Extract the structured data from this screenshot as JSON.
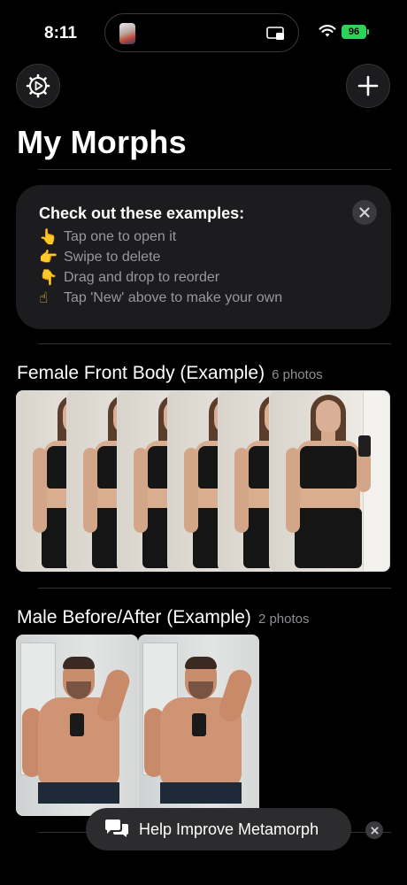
{
  "status_bar": {
    "time": "8:11",
    "battery": "96"
  },
  "header": {
    "title": "My Morphs"
  },
  "examples_card": {
    "heading": "Check out these examples:",
    "rows": [
      {
        "emoji": "👆",
        "text": "Tap one to open it"
      },
      {
        "emoji": "👉",
        "text": "Swipe to delete"
      },
      {
        "emoji": "👇",
        "text": "Drag and drop to reorder"
      },
      {
        "emoji": "☝",
        "text": "Tap 'New' above to make your own"
      }
    ]
  },
  "sections": [
    {
      "title": "Female Front Body (Example)",
      "count": "6 photos"
    },
    {
      "title": "Male Before/After (Example)",
      "count": "2 photos"
    }
  ],
  "toast": {
    "label": "Help Improve Metamorph"
  },
  "icons": {
    "settings": "gear-play-icon",
    "add": "plus-icon",
    "close": "close-icon",
    "chat": "chat-bubbles-icon"
  },
  "colors": {
    "background": "#000000",
    "card": "#1c1c1e",
    "battery": "#30d158",
    "secondary_text": "#98989d"
  }
}
